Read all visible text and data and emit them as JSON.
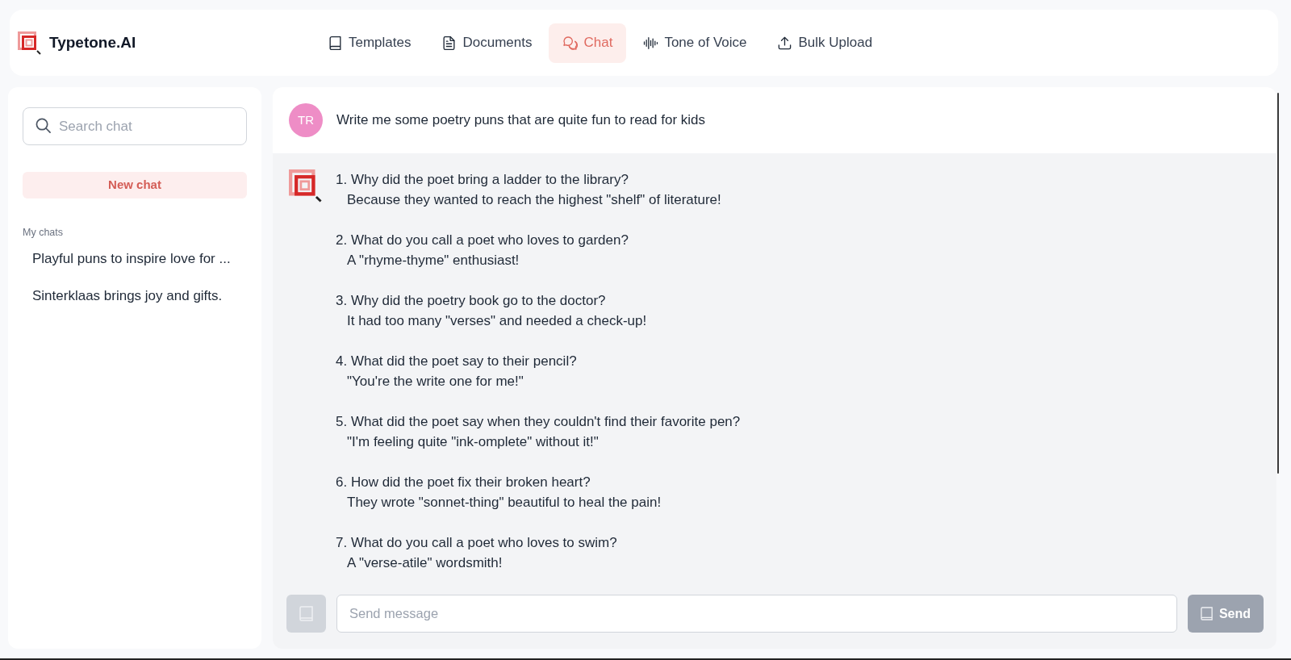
{
  "header": {
    "app_name": "Typetone.AI",
    "nav": [
      {
        "label": "Templates",
        "selected": false
      },
      {
        "label": "Documents",
        "selected": false
      },
      {
        "label": "Chat",
        "selected": true
      },
      {
        "label": "Tone of Voice",
        "selected": false
      },
      {
        "label": "Bulk Upload",
        "selected": false
      }
    ]
  },
  "sidebar": {
    "search": {
      "placeholder": "Search chat"
    },
    "new_chat_button": "New chat",
    "section_title": "My chats",
    "chats": [
      {
        "title": "Playful puns to inspire love for ...",
        "selected": false
      },
      {
        "title": "Sinterklaas brings joy and gifts.",
        "selected": false
      }
    ]
  },
  "conversation": {
    "user_message": {
      "avatar_initials": "TR",
      "text": "Write me some poetry puns that are quite fun to read for kids"
    },
    "assistant_message": {
      "items": [
        {
          "question": "1. Why did the poet bring a ladder to the library?",
          "answer": "Because they wanted to reach the highest \"shelf\" of literature!"
        },
        {
          "question": "2. What do you call a poet who loves to garden?",
          "answer": "A \"rhyme-thyme\" enthusiast!"
        },
        {
          "question": "3. Why did the poetry book go to the doctor?",
          "answer": "It had too many \"verses\" and needed a check-up!"
        },
        {
          "question": "4. What did the poet say to their pencil?",
          "answer": "\"You're the write one for me!\""
        },
        {
          "question": "5. What did the poet say when they couldn't find their favorite pen?",
          "answer": "\"I'm feeling quite \"ink-omplete\" without it!\""
        },
        {
          "question": "6. How did the poet fix their broken heart?",
          "answer": "They wrote \"sonnet-thing\" beautiful to heal the pain!"
        },
        {
          "question": "7. What do you call a poet who loves to swim?",
          "answer": "A \"verse-atile\" wordsmith!"
        }
      ]
    }
  },
  "composer": {
    "attach_button": {
      "disabled": true
    },
    "input": {
      "placeholder": "Send message"
    },
    "send_button": {
      "label": "Send",
      "disabled": true
    }
  }
}
